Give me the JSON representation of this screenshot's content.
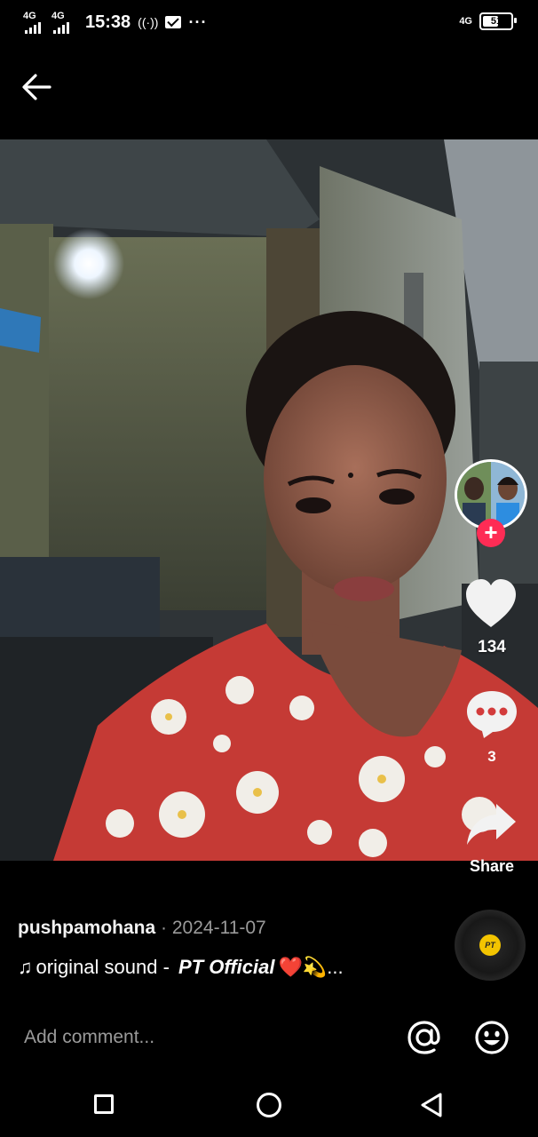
{
  "status_bar": {
    "network_1": "4G",
    "network_2": "4G",
    "time": "15:38",
    "hotspot_icon": "hotspot-icon",
    "mail_icon": "mail-icon",
    "more": "···",
    "right_network": "4G",
    "battery_level": "51"
  },
  "header": {
    "back_icon": "arrow-left-icon"
  },
  "video": {
    "content": "selfie-video-frame"
  },
  "actions": {
    "follow_symbol": "+",
    "likes": "134",
    "comments": "3",
    "share_label": "Share"
  },
  "post": {
    "username": "pushpamohana",
    "separator": "·",
    "date": "2024-11-07",
    "sound_prefix": "original sound - ",
    "sound_artist": "PT Official",
    "sound_suffix": "❤️💫...",
    "disc_label": "PT"
  },
  "comment_bar": {
    "placeholder": "Add comment...",
    "mention_icon": "at-sign-icon",
    "emoji_icon": "smiley-icon"
  },
  "nav": {
    "recent_icon": "square-icon",
    "home_icon": "circle-icon",
    "back_icon": "triangle-back-icon"
  },
  "colors": {
    "background": "#000000",
    "follow": "#fe2c55",
    "date": "#9a9a9a"
  }
}
